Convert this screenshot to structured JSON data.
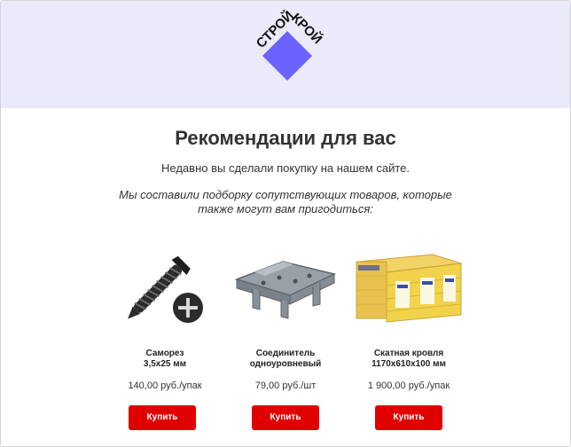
{
  "brand": {
    "logo_top": "СТРОЙ",
    "logo_right": "КРОЙ",
    "logo_color": "#6b63ff"
  },
  "heading": "Рекомендации для вас",
  "intro": "Недавно вы сделали покупку на нашем сайте.",
  "note": "Мы составили подборку сопутствующих товаров, которые также могут вам пригодиться:",
  "products": [
    {
      "name_line1": "Саморез",
      "name_line2": "3,5х25 мм",
      "price": "140,00 руб./упак",
      "button": "Купить",
      "image": "screw-icon"
    },
    {
      "name_line1": "Соединитель",
      "name_line2": "одноуровневый",
      "price": "79,00 руб./шт",
      "button": "Купить",
      "image": "connector-icon"
    },
    {
      "name_line1": "Скатная кровля",
      "name_line2": "1170х610х100 мм",
      "price": "1 900,00 руб./упак",
      "button": "Купить",
      "image": "insulation-pack-icon"
    }
  ],
  "colors": {
    "header_bg": "#eaeafb",
    "button": "#e00000",
    "accent": "#6b63ff"
  }
}
